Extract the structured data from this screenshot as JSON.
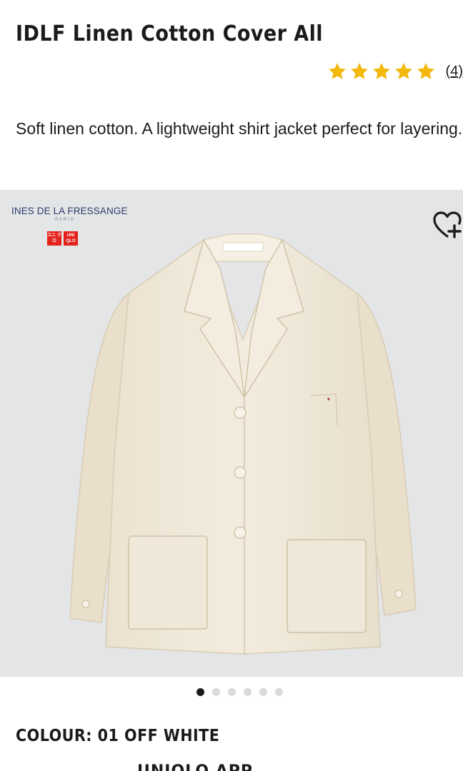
{
  "product": {
    "title": "IDLF Linen Cotton Cover All",
    "rating": {
      "stars": 5,
      "review_count": "(4)",
      "star_color": "#f2b80c"
    },
    "description": "Soft linen cotton. A lightweight shirt jacket perfect for layering."
  },
  "gallery": {
    "brand_name": "INES DE LA FRESSANGE",
    "brand_city": "PARIS",
    "partner_logo": [
      "ユニ クロ",
      "UNI QLO"
    ],
    "wishlist_icon": "heart-plus-icon",
    "image_color": "#f2ebdd",
    "background_color": "#e4e5e6",
    "dots_total": 6,
    "dots_active_index": 0
  },
  "colour_label": "COLOUR: 01 OFF WHITE",
  "app_banner_text": "UNIQLO APP"
}
